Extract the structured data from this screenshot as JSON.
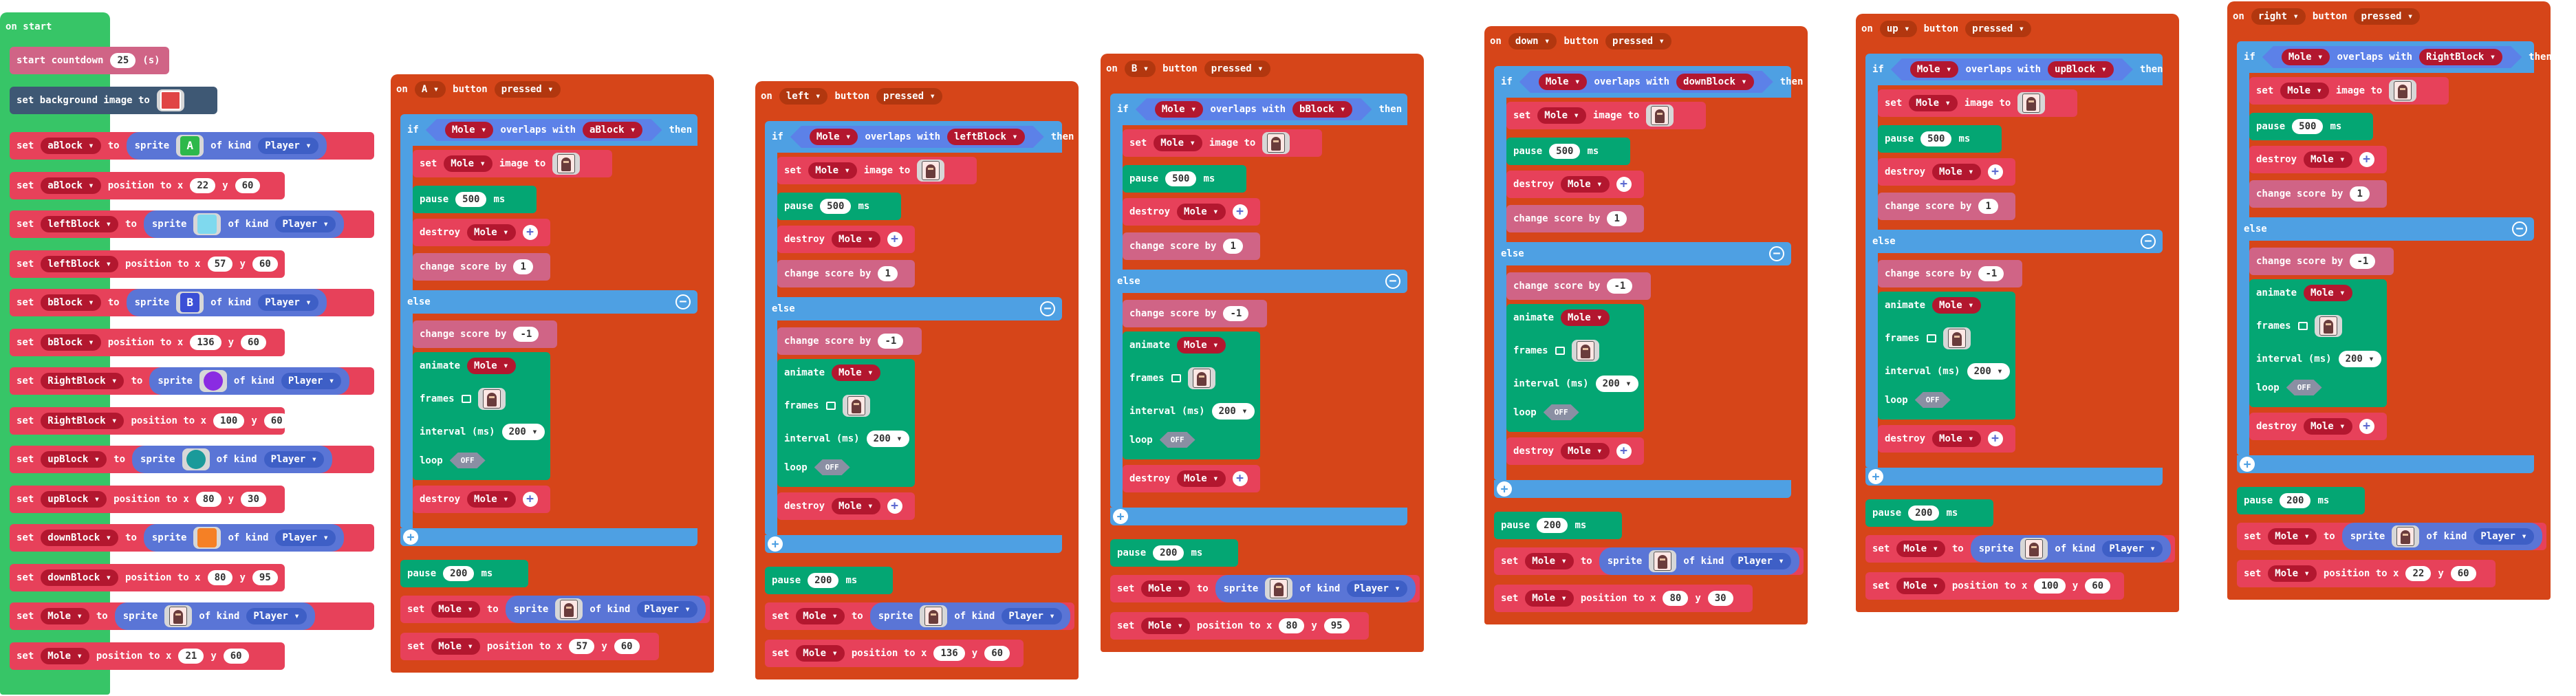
{
  "on_start": {
    "hat_label": "on start",
    "countdown": {
      "text": "start countdown",
      "value": "25",
      "unit": "(s)"
    },
    "background": {
      "text": "set background image to"
    },
    "kw": {
      "set": "set",
      "to": "to",
      "sprite": "sprite",
      "of_kind": "of kind",
      "position_to_x": "position to x",
      "y": "y"
    },
    "kind": "Player",
    "rows": [
      {
        "var": "aBlock",
        "x": "22",
        "y": "60",
        "color": "#2db84a",
        "glyph": "A"
      },
      {
        "var": "leftBlock",
        "x": "57",
        "y": "60",
        "color": "#7fd9ee",
        "glyph": ""
      },
      {
        "var": "bBlock",
        "x": "136",
        "y": "60",
        "color": "#3b4fd6",
        "glyph": "B"
      },
      {
        "var": "RightBlock",
        "x": "100",
        "y": "60",
        "color": "#8a2be2",
        "glyph": ""
      },
      {
        "var": "upBlock",
        "x": "80",
        "y": "30",
        "color": "#1a9a9a",
        "glyph": ""
      },
      {
        "var": "downBlock",
        "x": "80",
        "y": "95",
        "color": "#f58025",
        "glyph": ""
      },
      {
        "var": "Mole",
        "x": "21",
        "y": "60",
        "color": "mole",
        "glyph": ""
      }
    ]
  },
  "kw": {
    "on": "on",
    "button": "button",
    "pressed": "pressed",
    "if": "if",
    "overlaps_with": "overlaps with",
    "then": "then",
    "set": "set",
    "image_to": "image to",
    "pause": "pause",
    "ms": "ms",
    "destroy": "destroy",
    "change_score_by": "change score by",
    "else": "else",
    "animate": "animate",
    "frames": "frames",
    "interval": "interval (ms)",
    "loop": "loop",
    "off": "OFF",
    "to": "to",
    "sprite": "sprite",
    "of_kind": "of kind",
    "position_to_x": "position to x",
    "y": "y"
  },
  "handlers": [
    {
      "button": "A",
      "target": "aBlock",
      "score_true": "1",
      "score_false": "-1",
      "pause_in": "500",
      "interval": "200",
      "pause_out": "200",
      "mole": "Mole",
      "kind": "Player",
      "pos_x": "57",
      "pos_y": "60"
    },
    {
      "button": "left",
      "target": "leftBlock",
      "score_true": "1",
      "score_false": "-1",
      "pause_in": "500",
      "interval": "200",
      "pause_out": "200",
      "mole": "Mole",
      "kind": "Player",
      "pos_x": "136",
      "pos_y": "60"
    },
    {
      "button": "B",
      "target": "bBlock",
      "score_true": "1",
      "score_false": "-1",
      "pause_in": "500",
      "interval": "200",
      "pause_out": "200",
      "mole": "Mole",
      "kind": "Player",
      "pos_x": "80",
      "pos_y": "95"
    },
    {
      "button": "down",
      "target": "downBlock",
      "score_true": "1",
      "score_false": "-1",
      "pause_in": "500",
      "interval": "200",
      "pause_out": "200",
      "mole": "Mole",
      "kind": "Player",
      "pos_x": "80",
      "pos_y": "30"
    },
    {
      "button": "up",
      "target": "upBlock",
      "score_true": "1",
      "score_false": "-1",
      "pause_in": "500",
      "interval": "200",
      "pause_out": "200",
      "mole": "Mole",
      "kind": "Player",
      "pos_x": "100",
      "pos_y": "60"
    },
    {
      "button": "right",
      "target": "RightBlock",
      "score_true": "1",
      "score_false": "-1",
      "pause_in": "500",
      "interval": "200",
      "pause_out": "200",
      "mole": "Mole",
      "kind": "Player",
      "pos_x": "22",
      "pos_y": "60"
    }
  ],
  "colors": {
    "event_hat": "#d64519",
    "start_hat": "#37c567",
    "sprite": "#e7415a",
    "logic": "#4ea0e3",
    "info": "#d06486",
    "loops": "#04a673"
  }
}
